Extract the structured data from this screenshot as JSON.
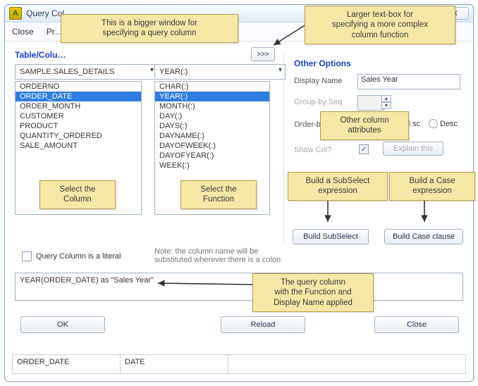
{
  "window": {
    "title": "Query Col…",
    "close_glyph": "✕"
  },
  "menu": {
    "close": "Close",
    "preview": "Pr…"
  },
  "labels": {
    "table_column": "Table/Colu…",
    "other_options": "Other Options",
    "display_name": "Display Name",
    "groupby_seq": "Group-by Seq",
    "orderby_seq": "Order-by S",
    "asc": "sc",
    "desc": "Desc",
    "show_col": "Show Col?",
    "literal": "Query Column is a literal",
    "note": "Note: the column name will be\nsubstituted wherever there is a colon"
  },
  "expand_btn": ">>>",
  "tableCombo": {
    "value": "SAMPLE.SALES_DETAILS"
  },
  "funcCombo": {
    "value": "YEAR(:)"
  },
  "columnList": {
    "items": [
      "ORDERNO",
      "ORDER_DATE",
      "ORDER_MONTH",
      "CUSTOMER",
      "PRODUCT",
      "QUANTITY_ORDERED",
      "SALE_AMOUNT"
    ],
    "selected_index": 1
  },
  "funcList": {
    "items": [
      "CHAR(:)",
      "YEAR(:)",
      "MONTH(:)",
      "DAY(:)",
      "DAYS(:)",
      "DAYNAME(:)",
      "DAYOFWEEK(:)",
      "DAYOFYEAR(:)",
      "WEEK(:)"
    ],
    "selected_index": 1
  },
  "displayName": "Sales Year",
  "orderRadios": {
    "selected": "asc"
  },
  "showColChecked": true,
  "buttons": {
    "explain": "Explain this",
    "subselect": "Build SubSelect",
    "caseclause": "Build Case clause",
    "ok": "OK",
    "reload": "Reload",
    "close": "Close"
  },
  "resultExpr": "YEAR(ORDER_DATE) as \"Sales Year\"",
  "statusRow": {
    "col1": "ORDER_DATE",
    "col2": "DATE"
  },
  "annotations": {
    "a_main": "This is a bigger window for\nspecifying a query column",
    "a_expand": "Larger text-box for\nspecifying a more complex\ncolumn function",
    "a_selcol": "Select the\nColumn",
    "a_selfunc": "Select the\nFunction",
    "a_otherattrs": "Other column\nattributes",
    "a_subsel": "Build a SubSelect\nexpression",
    "a_case": "Build a Case\nexpression",
    "a_result": "The query column\nwith the Function and\nDisplay Name applied"
  }
}
